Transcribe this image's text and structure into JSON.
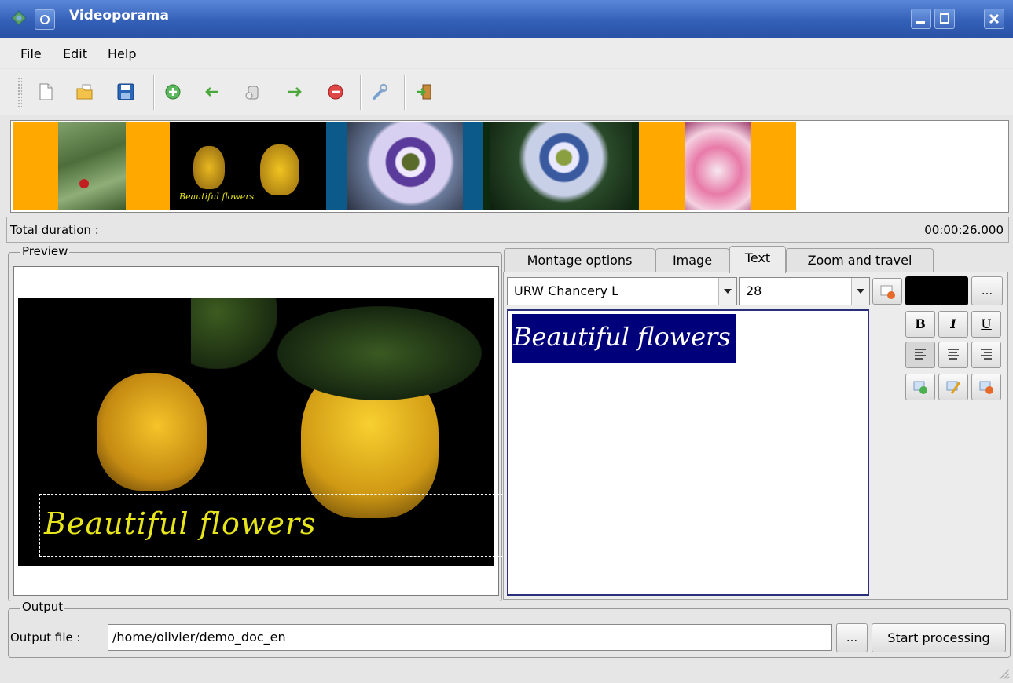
{
  "window": {
    "title": "Videoporama"
  },
  "menu": {
    "file": "File",
    "edit": "Edit",
    "help": "Help"
  },
  "toolbar": {
    "icons": [
      "new-document-icon",
      "open-folder-icon",
      "save-icon",
      "add-image-icon",
      "move-left-icon",
      "delete-image-icon",
      "move-right-icon",
      "remove-icon",
      "settings-wrench-icon",
      "exit-icon"
    ]
  },
  "filmstrip": {
    "caption": "Beautiful flowers",
    "colors": {
      "orange": "#ffa800",
      "blue": "#0c5a8a"
    }
  },
  "status": {
    "total_label": "Total duration :",
    "total_value": "00:00:26.000"
  },
  "preview": {
    "group_label": "Preview",
    "overlay_text": "Beautiful flowers",
    "text_color": "#e8e61a"
  },
  "tabs": {
    "montage": "Montage options",
    "image": "Image",
    "text": "Text",
    "zoom": "Zoom and travel",
    "active": "Text"
  },
  "text_tab": {
    "font": "URW Chancery L",
    "size": "28",
    "color": "#000000",
    "more_label": "...",
    "bold": "B",
    "italic": "I",
    "underline": "U",
    "editor_text": "Beautiful flowers",
    "selection_color": "#00007a"
  },
  "output": {
    "group_label": "Output",
    "file_label": "Output file :",
    "file_value": "/home/olivier/demo_doc_en",
    "browse_label": "...",
    "start_label": "Start processing"
  }
}
